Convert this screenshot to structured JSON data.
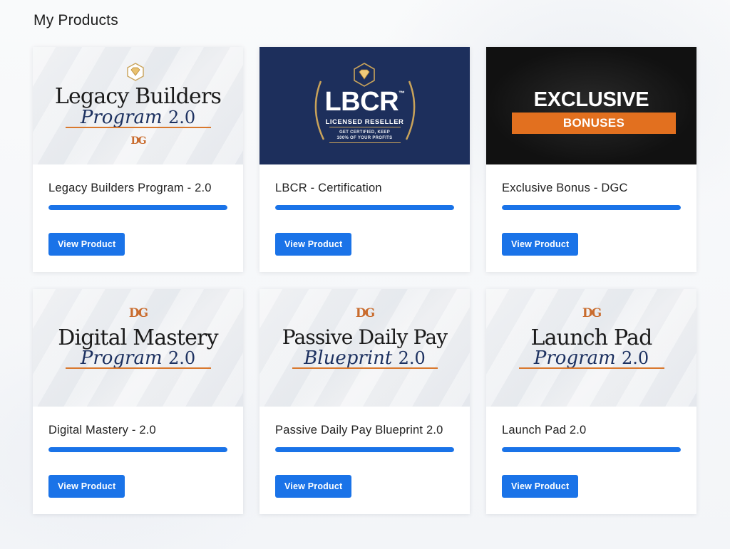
{
  "page": {
    "title": "My Products"
  },
  "colors": {
    "accent": "#1a73e8",
    "navy": "#1d2f5c",
    "orange": "#e2701f"
  },
  "products": [
    {
      "name": "Legacy Builders Program - 2.0",
      "button": "View Product",
      "progress": 1.0,
      "thumbnail": {
        "line1": "Legacy Builders",
        "script": "Program",
        "version": "2.0",
        "mark": "DG"
      }
    },
    {
      "name": "LBCR - Certification",
      "button": "View Product",
      "progress": 1.0,
      "thumbnail": {
        "logo": "LBCR",
        "tm": "™",
        "subtitle": "LICENSED RESELLER",
        "tagline1": "GET CERTIFIED, KEEP",
        "tagline2": "100% OF YOUR PROFITS"
      }
    },
    {
      "name": "Exclusive Bonus - DGC",
      "button": "View Product",
      "progress": 1.0,
      "thumbnail": {
        "line1": "EXCLUSIVE",
        "line2": "BONUSES"
      }
    },
    {
      "name": "Digital Mastery - 2.0",
      "button": "View Product",
      "progress": 1.0,
      "thumbnail": {
        "mark": "DG",
        "line1": "Digital Mastery",
        "script": "Program",
        "version": "2.0"
      }
    },
    {
      "name": "Passive Daily Pay Blueprint 2.0",
      "button": "View Product",
      "progress": 1.0,
      "thumbnail": {
        "mark": "DG",
        "line1": "Passive Daily Pay",
        "script": "Blueprint",
        "version": "2.0"
      }
    },
    {
      "name": "Launch Pad 2.0",
      "button": "View Product",
      "progress": 1.0,
      "thumbnail": {
        "mark": "DG",
        "line1": "Launch Pad",
        "script": "Program",
        "version": "2.0"
      }
    }
  ]
}
